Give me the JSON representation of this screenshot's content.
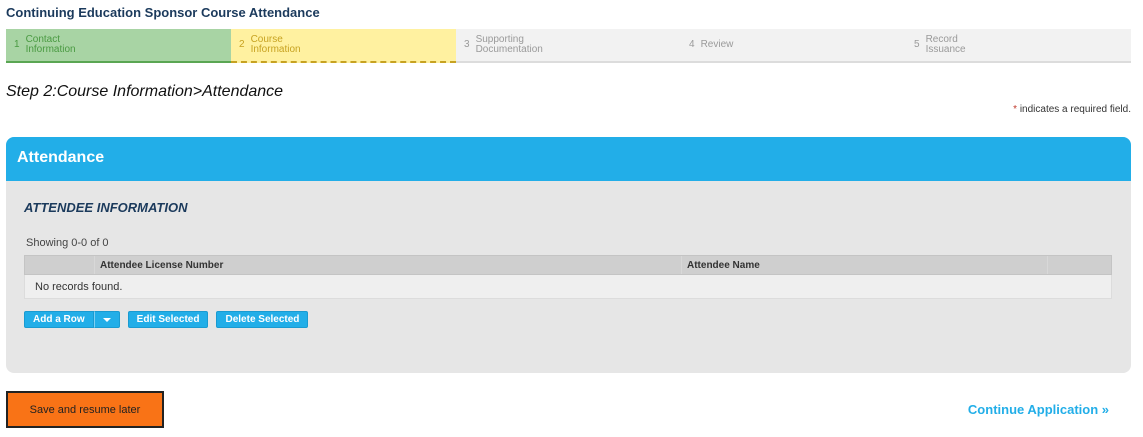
{
  "page": {
    "title": "Continuing Education Sponsor Course Attendance"
  },
  "stepper": [
    {
      "num": "1",
      "label": "Contact Information",
      "state": "done"
    },
    {
      "num": "2",
      "label": "Course Information",
      "state": "current"
    },
    {
      "num": "3",
      "label": "Supporting Documentation",
      "state": "todo"
    },
    {
      "num": "4",
      "label": "Review",
      "state": "todo"
    },
    {
      "num": "5",
      "label": "Record Issuance",
      "state": "todo"
    }
  ],
  "step_heading": "Step 2:Course Information>Attendance",
  "required_note": {
    "star": "*",
    "text": "indicates a required field."
  },
  "panel": {
    "title": "Attendance",
    "section_title": "ATTENDEE INFORMATION",
    "showing": "Showing 0-0 of 0",
    "columns": [
      "",
      "Attendee License Number",
      "Attendee Name",
      ""
    ],
    "empty_text": "No records found.",
    "buttons": {
      "add_row": "Add a Row",
      "edit_selected": "Edit Selected",
      "delete_selected": "Delete Selected"
    }
  },
  "footer": {
    "save_label": "Save and resume later",
    "continue_label": "Continue Application »"
  },
  "colors": {
    "accent": "#22aee8",
    "save": "#f97316",
    "done": "#a8d4a4",
    "current": "#fff1a0"
  }
}
